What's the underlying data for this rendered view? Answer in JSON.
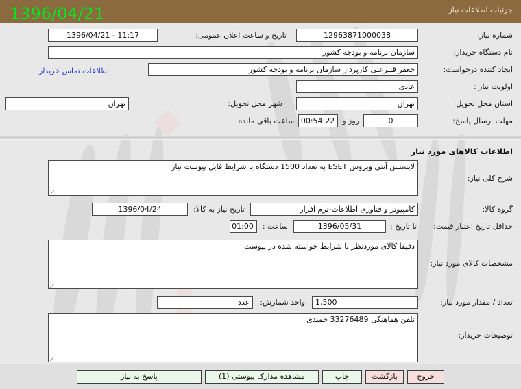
{
  "window": {
    "title": "جزئیات اطلاعات نیاز",
    "overlay_date": "1396/04/21",
    "title_bar_color": "#8b6a3f",
    "overlay_date_color": "#00e61e",
    "link_color": "#2b39c4"
  },
  "top_form": {
    "need_number_label": "شماره نیاز:",
    "need_number_value": "12963871000038",
    "announce_datetime_label": "تاریخ و ساعت اعلان عمومی:",
    "announce_datetime_value": "11:17 - 1396/04/21",
    "buyer_org_label": "نام دستگاه خریدار:",
    "buyer_org_value": "سازمان برنامه و بودجه کشور",
    "requester_label": "ایجاد کننده درخواست:",
    "requester_value": "جعفر قنبرعلی کارپرداز سازمان برنامه و بودجه کشور",
    "contact_link": "اطلاعات تماس خریدار",
    "priority_label": "اولویت نیاز :",
    "priority_value": "عادی",
    "province_label": "استان محل تحویل:",
    "province_value": "تهران",
    "city_label": "شهر محل تحویل:",
    "city_value": "تهران",
    "deadline_label": "مهلت ارسال پاسخ:",
    "deadline_days": "0",
    "deadline_days_unit": "روز و",
    "deadline_time": "00:54:22",
    "deadline_suffix": "ساعت باقی مانده"
  },
  "goods_section": {
    "section_title": "اطلاعات کالاهای مورد نیاز",
    "general_desc_label": "شرح کلی نیاز:",
    "general_desc_value": "لایسنس آنتی ویروس ESET به تعداد 1500 دستگاه با شرایط فایل پیوست نیاز",
    "goods_group_label": "گروه کالا:",
    "goods_group_value": "کامپیوتر و فناوری اطلاعات-نرم افزار",
    "need_date_label": "تاریخ نیاز به کالا:",
    "need_date_value": "1396/04/24",
    "price_validity_label": "حداقل تاریخ اعتبار قیمت:",
    "price_validity_to_label": "تا تاریخ :",
    "price_validity_date": "1396/05/31",
    "price_validity_time_label": "ساعت :",
    "price_validity_time": "01:00",
    "specs_label": "مشخصات کالای مورد نیاز:",
    "specs_value": "دقیقا کالای موردنظر با شرایط خواسته شده در پیوست",
    "quantity_label": "تعداد / مقدار مورد نیاز:",
    "quantity_value": "1,500",
    "unit_label": "واحد شمارش:",
    "unit_value": "عدد",
    "buyer_notes_label": "توضیحات خریدار:",
    "buyer_notes_value": "تلفن هماهنگی 33276489 حمیدی"
  },
  "footer": {
    "respond_button": "پاسخ به نیاز",
    "attachments_button": "مشاهده مدارک پیوستی (1)",
    "print_button": "چاپ",
    "back_button": "بازگشت",
    "exit_button": "خروج"
  }
}
